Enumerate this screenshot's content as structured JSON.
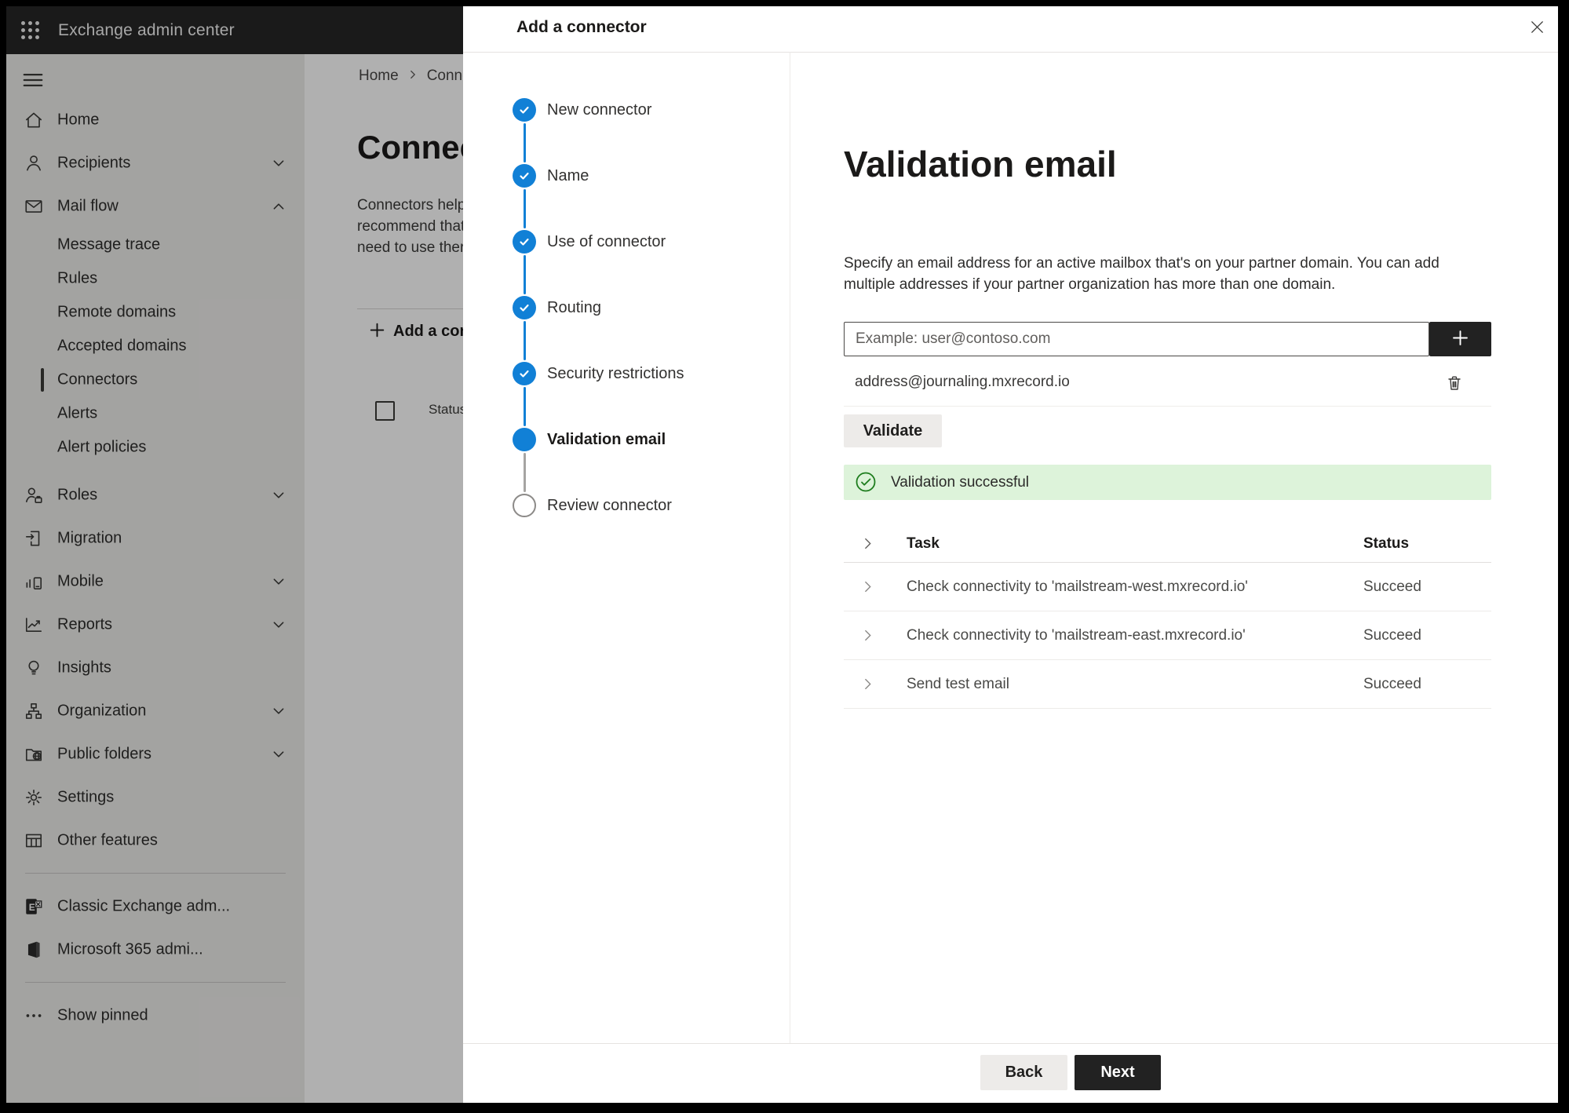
{
  "topbar": {
    "app_title": "Exchange admin center"
  },
  "sidebar": {
    "items": [
      {
        "type": "item",
        "label": "Home",
        "icon": "home-icon"
      },
      {
        "type": "item",
        "label": "Recipients",
        "icon": "person-icon",
        "chevron": "down"
      },
      {
        "type": "item",
        "label": "Mail flow",
        "icon": "mail-icon",
        "chevron": "up"
      },
      {
        "type": "subitem",
        "label": "Message trace"
      },
      {
        "type": "subitem",
        "label": "Rules"
      },
      {
        "type": "subitem",
        "label": "Remote domains"
      },
      {
        "type": "subitem",
        "label": "Accepted domains"
      },
      {
        "type": "subitem",
        "label": "Connectors",
        "selected": true
      },
      {
        "type": "subitem",
        "label": "Alerts"
      },
      {
        "type": "subitem",
        "label": "Alert policies"
      },
      {
        "type": "item",
        "label": "Roles",
        "icon": "roles-icon",
        "chevron": "down"
      },
      {
        "type": "item",
        "label": "Migration",
        "icon": "migration-icon"
      },
      {
        "type": "item",
        "label": "Mobile",
        "icon": "mobile-icon",
        "chevron": "down"
      },
      {
        "type": "item",
        "label": "Reports",
        "icon": "reports-icon",
        "chevron": "down"
      },
      {
        "type": "item",
        "label": "Insights",
        "icon": "insights-icon"
      },
      {
        "type": "item",
        "label": "Organization",
        "icon": "organization-icon",
        "chevron": "down"
      },
      {
        "type": "item",
        "label": "Public folders",
        "icon": "public-folders-icon",
        "chevron": "down"
      },
      {
        "type": "item",
        "label": "Settings",
        "icon": "settings-icon"
      },
      {
        "type": "item",
        "label": "Other features",
        "icon": "other-features-icon"
      },
      {
        "type": "divider"
      },
      {
        "type": "item",
        "label": "Classic Exchange adm...",
        "icon": "classic-exchange-icon"
      },
      {
        "type": "item",
        "label": "Microsoft 365 admi...",
        "icon": "microsoft-365-icon"
      },
      {
        "type": "divider"
      },
      {
        "type": "item",
        "label": "Show pinned",
        "icon": "ellipsis-icon"
      }
    ]
  },
  "page": {
    "breadcrumb": {
      "home": "Home",
      "current_fragment": "Conne"
    },
    "title_fragment": "Connec",
    "description_lines": [
      "Connectors help",
      "recommend that",
      "need to use ther"
    ],
    "add_button_fragment": "Add a conn",
    "table_status_header": "Status"
  },
  "modal": {
    "title": "Add a connector",
    "steps": [
      {
        "label": "New connector",
        "state": "completed"
      },
      {
        "label": "Name",
        "state": "completed"
      },
      {
        "label": "Use of connector",
        "state": "completed"
      },
      {
        "label": "Routing",
        "state": "completed"
      },
      {
        "label": "Security restrictions",
        "state": "completed"
      },
      {
        "label": "Validation email",
        "state": "current"
      },
      {
        "label": "Review connector",
        "state": "upcoming"
      }
    ],
    "content": {
      "heading": "Validation email",
      "description": "Specify an email address for an active mailbox that's on your partner domain. You can add multiple addresses if your partner organization has more than one domain.",
      "email_input": {
        "placeholder": "Example: user@contoso.com",
        "value": ""
      },
      "addresses": [
        "address@journaling.mxrecord.io"
      ],
      "validate_label": "Validate",
      "banner": {
        "text": "Validation successful",
        "status": "success"
      },
      "table": {
        "headers": {
          "task": "Task",
          "status": "Status"
        },
        "rows": [
          {
            "task": "Check connectivity to 'mailstream-west.mxrecord.io'",
            "status": "Succeed"
          },
          {
            "task": "Check connectivity to 'mailstream-east.mxrecord.io'",
            "status": "Succeed"
          },
          {
            "task": "Send test email",
            "status": "Succeed"
          }
        ]
      }
    },
    "footer": {
      "back_label": "Back",
      "next_label": "Next"
    }
  },
  "colors": {
    "accent_blue": "#1180d6",
    "success_green": "#1e7d1e",
    "success_banner_bg": "#ddf3da",
    "dark_button": "#222222"
  }
}
